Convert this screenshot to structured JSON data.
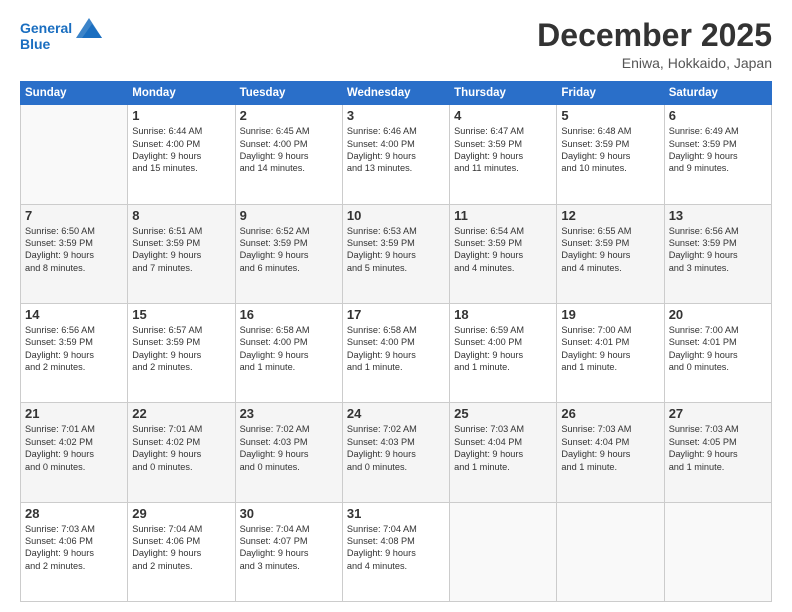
{
  "header": {
    "logo_line1": "General",
    "logo_line2": "Blue",
    "month": "December 2025",
    "location": "Eniwa, Hokkaido, Japan"
  },
  "weekdays": [
    "Sunday",
    "Monday",
    "Tuesday",
    "Wednesday",
    "Thursday",
    "Friday",
    "Saturday"
  ],
  "weeks": [
    [
      {
        "day": "",
        "lines": []
      },
      {
        "day": "1",
        "lines": [
          "Sunrise: 6:44 AM",
          "Sunset: 4:00 PM",
          "Daylight: 9 hours",
          "and 15 minutes."
        ]
      },
      {
        "day": "2",
        "lines": [
          "Sunrise: 6:45 AM",
          "Sunset: 4:00 PM",
          "Daylight: 9 hours",
          "and 14 minutes."
        ]
      },
      {
        "day": "3",
        "lines": [
          "Sunrise: 6:46 AM",
          "Sunset: 4:00 PM",
          "Daylight: 9 hours",
          "and 13 minutes."
        ]
      },
      {
        "day": "4",
        "lines": [
          "Sunrise: 6:47 AM",
          "Sunset: 3:59 PM",
          "Daylight: 9 hours",
          "and 11 minutes."
        ]
      },
      {
        "day": "5",
        "lines": [
          "Sunrise: 6:48 AM",
          "Sunset: 3:59 PM",
          "Daylight: 9 hours",
          "and 10 minutes."
        ]
      },
      {
        "day": "6",
        "lines": [
          "Sunrise: 6:49 AM",
          "Sunset: 3:59 PM",
          "Daylight: 9 hours",
          "and 9 minutes."
        ]
      }
    ],
    [
      {
        "day": "7",
        "lines": [
          "Sunrise: 6:50 AM",
          "Sunset: 3:59 PM",
          "Daylight: 9 hours",
          "and 8 minutes."
        ]
      },
      {
        "day": "8",
        "lines": [
          "Sunrise: 6:51 AM",
          "Sunset: 3:59 PM",
          "Daylight: 9 hours",
          "and 7 minutes."
        ]
      },
      {
        "day": "9",
        "lines": [
          "Sunrise: 6:52 AM",
          "Sunset: 3:59 PM",
          "Daylight: 9 hours",
          "and 6 minutes."
        ]
      },
      {
        "day": "10",
        "lines": [
          "Sunrise: 6:53 AM",
          "Sunset: 3:59 PM",
          "Daylight: 9 hours",
          "and 5 minutes."
        ]
      },
      {
        "day": "11",
        "lines": [
          "Sunrise: 6:54 AM",
          "Sunset: 3:59 PM",
          "Daylight: 9 hours",
          "and 4 minutes."
        ]
      },
      {
        "day": "12",
        "lines": [
          "Sunrise: 6:55 AM",
          "Sunset: 3:59 PM",
          "Daylight: 9 hours",
          "and 4 minutes."
        ]
      },
      {
        "day": "13",
        "lines": [
          "Sunrise: 6:56 AM",
          "Sunset: 3:59 PM",
          "Daylight: 9 hours",
          "and 3 minutes."
        ]
      }
    ],
    [
      {
        "day": "14",
        "lines": [
          "Sunrise: 6:56 AM",
          "Sunset: 3:59 PM",
          "Daylight: 9 hours",
          "and 2 minutes."
        ]
      },
      {
        "day": "15",
        "lines": [
          "Sunrise: 6:57 AM",
          "Sunset: 3:59 PM",
          "Daylight: 9 hours",
          "and 2 minutes."
        ]
      },
      {
        "day": "16",
        "lines": [
          "Sunrise: 6:58 AM",
          "Sunset: 4:00 PM",
          "Daylight: 9 hours",
          "and 1 minute."
        ]
      },
      {
        "day": "17",
        "lines": [
          "Sunrise: 6:58 AM",
          "Sunset: 4:00 PM",
          "Daylight: 9 hours",
          "and 1 minute."
        ]
      },
      {
        "day": "18",
        "lines": [
          "Sunrise: 6:59 AM",
          "Sunset: 4:00 PM",
          "Daylight: 9 hours",
          "and 1 minute."
        ]
      },
      {
        "day": "19",
        "lines": [
          "Sunrise: 7:00 AM",
          "Sunset: 4:01 PM",
          "Daylight: 9 hours",
          "and 1 minute."
        ]
      },
      {
        "day": "20",
        "lines": [
          "Sunrise: 7:00 AM",
          "Sunset: 4:01 PM",
          "Daylight: 9 hours",
          "and 0 minutes."
        ]
      }
    ],
    [
      {
        "day": "21",
        "lines": [
          "Sunrise: 7:01 AM",
          "Sunset: 4:02 PM",
          "Daylight: 9 hours",
          "and 0 minutes."
        ]
      },
      {
        "day": "22",
        "lines": [
          "Sunrise: 7:01 AM",
          "Sunset: 4:02 PM",
          "Daylight: 9 hours",
          "and 0 minutes."
        ]
      },
      {
        "day": "23",
        "lines": [
          "Sunrise: 7:02 AM",
          "Sunset: 4:03 PM",
          "Daylight: 9 hours",
          "and 0 minutes."
        ]
      },
      {
        "day": "24",
        "lines": [
          "Sunrise: 7:02 AM",
          "Sunset: 4:03 PM",
          "Daylight: 9 hours",
          "and 0 minutes."
        ]
      },
      {
        "day": "25",
        "lines": [
          "Sunrise: 7:03 AM",
          "Sunset: 4:04 PM",
          "Daylight: 9 hours",
          "and 1 minute."
        ]
      },
      {
        "day": "26",
        "lines": [
          "Sunrise: 7:03 AM",
          "Sunset: 4:04 PM",
          "Daylight: 9 hours",
          "and 1 minute."
        ]
      },
      {
        "day": "27",
        "lines": [
          "Sunrise: 7:03 AM",
          "Sunset: 4:05 PM",
          "Daylight: 9 hours",
          "and 1 minute."
        ]
      }
    ],
    [
      {
        "day": "28",
        "lines": [
          "Sunrise: 7:03 AM",
          "Sunset: 4:06 PM",
          "Daylight: 9 hours",
          "and 2 minutes."
        ]
      },
      {
        "day": "29",
        "lines": [
          "Sunrise: 7:04 AM",
          "Sunset: 4:06 PM",
          "Daylight: 9 hours",
          "and 2 minutes."
        ]
      },
      {
        "day": "30",
        "lines": [
          "Sunrise: 7:04 AM",
          "Sunset: 4:07 PM",
          "Daylight: 9 hours",
          "and 3 minutes."
        ]
      },
      {
        "day": "31",
        "lines": [
          "Sunrise: 7:04 AM",
          "Sunset: 4:08 PM",
          "Daylight: 9 hours",
          "and 4 minutes."
        ]
      },
      {
        "day": "",
        "lines": []
      },
      {
        "day": "",
        "lines": []
      },
      {
        "day": "",
        "lines": []
      }
    ]
  ]
}
